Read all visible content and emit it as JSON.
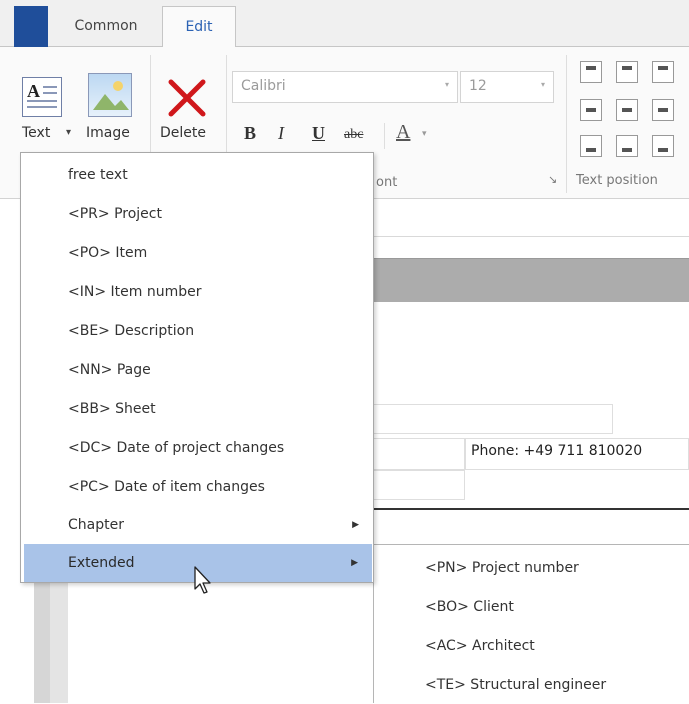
{
  "tabs": [
    {
      "label": "Common"
    },
    {
      "label": "Edit"
    }
  ],
  "ribbon": {
    "text_button": {
      "label": "Text",
      "arrow": "▾"
    },
    "image_button": {
      "label": "Image"
    },
    "delete_button": {
      "label": "Delete"
    },
    "font_combo": {
      "value": "Calibri",
      "arrow": "▾"
    },
    "size_combo": {
      "value": "12",
      "arrow": "▾"
    },
    "bold": "B",
    "italic": "I",
    "underline": "U",
    "strike": "abc",
    "font_color": "A",
    "font_color_arrow": "▾",
    "font_group_label_visible": "ont",
    "launcher": "↘",
    "text_position_label": "Text position"
  },
  "menu": {
    "items": [
      {
        "label": "free text"
      },
      {
        "label": "<PR> Project"
      },
      {
        "label": "<PO> Item"
      },
      {
        "label": "<IN> Item number"
      },
      {
        "label": "<BE> Description"
      },
      {
        "label": "<NN> Page"
      },
      {
        "label": "<BB> Sheet"
      },
      {
        "label": "<DC> Date of project changes"
      },
      {
        "label": "<PC> Date of item changes"
      },
      {
        "label": "Chapter"
      },
      {
        "label": "Extended"
      }
    ],
    "submenu_arrow": "▶"
  },
  "submenu": {
    "items": [
      {
        "label": "<PN> Project number"
      },
      {
        "label": "<BO> Client"
      },
      {
        "label": "<AC> Architect"
      },
      {
        "label": "<TE> Structural engineer"
      }
    ]
  },
  "document": {
    "phone": "Phone: +49 711 810020"
  },
  "colors": {
    "accent": "#2b62b4",
    "highlight": "#a9c3e8",
    "delete_red": "#d0171b",
    "file_tab": "#1f4e9a"
  }
}
